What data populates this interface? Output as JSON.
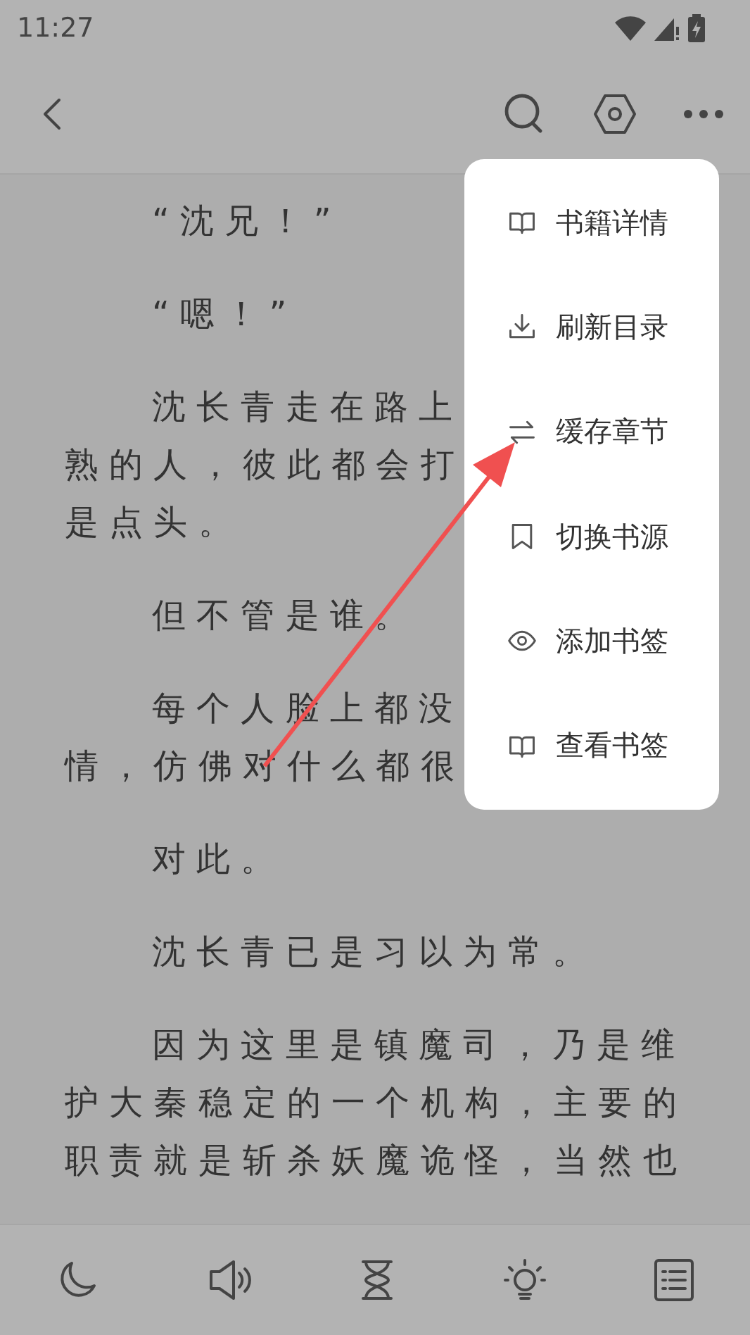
{
  "status_bar": {
    "time": "11:27"
  },
  "paragraphs": [
    {
      "lines": [
        "“沈兄！”"
      ]
    },
    {
      "lines": [
        "“嗯！”"
      ]
    },
    {
      "lines": [
        "沈长青走在路上",
        "熟的人，彼此都会打",
        "是点头。"
      ]
    },
    {
      "lines": [
        "但不管是谁。"
      ]
    },
    {
      "lines": [
        "每个人脸上都没",
        "情，仿佛对什么都很"
      ]
    },
    {
      "lines": [
        "对此。"
      ]
    },
    {
      "lines": [
        "沈长青已是习以为常。"
      ]
    },
    {
      "lines": [
        "因为这里是镇魔司，乃是维",
        "护大秦稳定的一个机构，主要的",
        "职责就是斩杀妖魔诡怪，当然也"
      ]
    }
  ],
  "menu": {
    "items": [
      {
        "label": "书籍详情",
        "kind": "book"
      },
      {
        "label": "刷新目录",
        "kind": "download"
      },
      {
        "label": "缓存章节",
        "kind": "swap"
      },
      {
        "label": "切换书源",
        "kind": "bookmark"
      },
      {
        "label": "添加书签",
        "kind": "eye"
      },
      {
        "label": "查看书签",
        "kind": "book"
      }
    ]
  }
}
